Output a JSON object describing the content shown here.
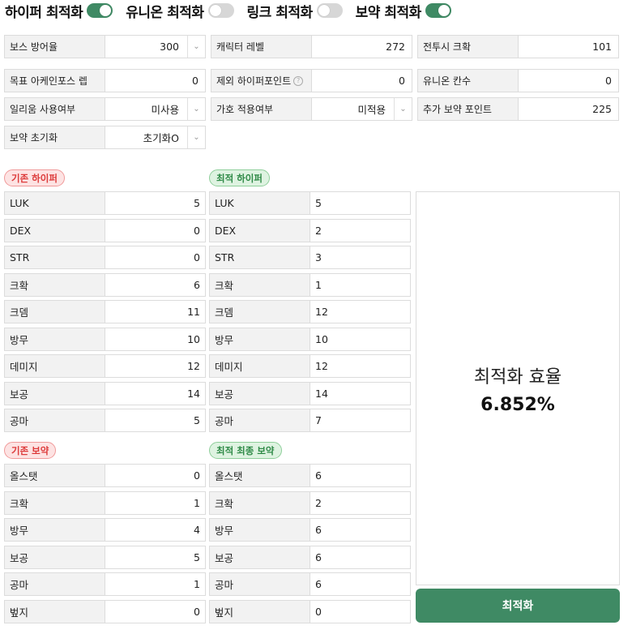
{
  "toggles": [
    {
      "label": "하이퍼 최적화",
      "on": true
    },
    {
      "label": "유니온 최적화",
      "on": false
    },
    {
      "label": "링크 최적화",
      "on": false
    },
    {
      "label": "보약 최적화",
      "on": true
    }
  ],
  "settings": {
    "boss_defense": {
      "label": "보스 방어율",
      "value": "300"
    },
    "char_level": {
      "label": "캐릭터 레벨",
      "value": "272"
    },
    "combat_crit": {
      "label": "전투시 크확",
      "value": "101"
    },
    "arcane_level": {
      "label": "목표 아케인포스 렙",
      "value": "0"
    },
    "excluded_hyper": {
      "label": "제외 하이퍼포인트",
      "value": "0",
      "help": "?"
    },
    "union_slots": {
      "label": "유니온 칸수",
      "value": "0"
    },
    "ilium": {
      "label": "일리움 사용여부",
      "value": "미사용"
    },
    "blessing": {
      "label": "가호 적용여부",
      "value": "미적용"
    },
    "extra_potion": {
      "label": "추가 보약 포인트",
      "value": "225"
    },
    "potion_reset": {
      "label": "보약 초기화",
      "value": "초기화O"
    }
  },
  "current_hyper": {
    "title": "기존 하이퍼",
    "rows": [
      {
        "label": "LUK",
        "value": "5"
      },
      {
        "label": "DEX",
        "value": "0"
      },
      {
        "label": "STR",
        "value": "0"
      },
      {
        "label": "크확",
        "value": "6"
      },
      {
        "label": "크뎀",
        "value": "11"
      },
      {
        "label": "방무",
        "value": "10"
      },
      {
        "label": "데미지",
        "value": "12"
      },
      {
        "label": "보공",
        "value": "14"
      },
      {
        "label": "공마",
        "value": "5"
      }
    ]
  },
  "optimal_hyper": {
    "title": "최적 하이퍼",
    "rows": [
      {
        "label": "LUK",
        "value": "5"
      },
      {
        "label": "DEX",
        "value": "2"
      },
      {
        "label": "STR",
        "value": "3"
      },
      {
        "label": "크확",
        "value": "1"
      },
      {
        "label": "크뎀",
        "value": "12"
      },
      {
        "label": "방무",
        "value": "10"
      },
      {
        "label": "데미지",
        "value": "12"
      },
      {
        "label": "보공",
        "value": "14"
      },
      {
        "label": "공마",
        "value": "7"
      }
    ]
  },
  "current_potion": {
    "title": "기존 보약",
    "rows": [
      {
        "label": "올스탯",
        "value": "0"
      },
      {
        "label": "크확",
        "value": "1"
      },
      {
        "label": "방무",
        "value": "4"
      },
      {
        "label": "보공",
        "value": "5"
      },
      {
        "label": "공마",
        "value": "1"
      },
      {
        "label": "벞지",
        "value": "0"
      }
    ]
  },
  "optimal_potion": {
    "title": "최적 최종 보약",
    "rows": [
      {
        "label": "올스탯",
        "value": "6"
      },
      {
        "label": "크확",
        "value": "2"
      },
      {
        "label": "방무",
        "value": "6"
      },
      {
        "label": "보공",
        "value": "6"
      },
      {
        "label": "공마",
        "value": "6"
      },
      {
        "label": "벞지",
        "value": "0"
      }
    ]
  },
  "efficiency": {
    "title": "최적화 효율",
    "value": "6.852%"
  },
  "optimize_button": "최적화",
  "colors": {
    "accent": "#3f8a64",
    "red_badge": "#dd3b3b",
    "green_badge": "#2f8a47"
  }
}
